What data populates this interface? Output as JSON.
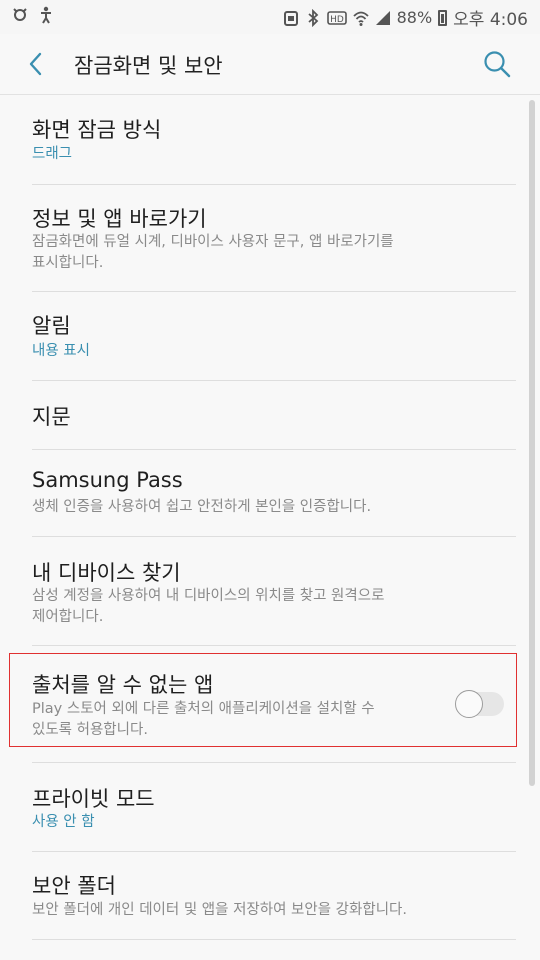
{
  "status_bar": {
    "battery": "88%",
    "time": "오후 4:06",
    "icons": [
      "notification-icon",
      "accessibility-icon",
      "storage-icon",
      "bluetooth-icon",
      "hd-icon",
      "wifi-icon",
      "signal-icon",
      "battery-icon"
    ]
  },
  "header": {
    "title": "잠금화면 및 보안",
    "back_icon": "back-arrow-icon",
    "search_icon": "search-icon"
  },
  "accent_color": "#3a8fb0",
  "items": [
    {
      "title": "화면 잠금 방식",
      "subtitle": "드래그"
    },
    {
      "title": "정보 및 앱 바로가기",
      "subtitle_l1": "잠금화면에 듀얼 시계, 디바이스 사용자 문구, 앱 바로가기를",
      "subtitle_l2": "표시합니다."
    },
    {
      "title": "알림",
      "subtitle": "내용 표시"
    },
    {
      "title": "지문"
    },
    {
      "title": "Samsung Pass",
      "subtitle": "생체 인증을 사용하여 쉽고 안전하게 본인을 인증합니다."
    },
    {
      "title": "내 디바이스 찾기",
      "subtitle_l1": "삼성 계정을 사용하여 내 디바이스의 위치를 찾고 원격으로",
      "subtitle_l2": "제어합니다."
    },
    {
      "title": "출처를 알 수 없는 앱",
      "subtitle_l1": "Play 스토어 외에 다른 출처의 애플리케이션을 설치할 수",
      "subtitle_l2": "있도록 허용합니다.",
      "toggle_on": false
    },
    {
      "title": "프라이빗 모드",
      "subtitle": "사용 안 함"
    },
    {
      "title": "보안 폴더",
      "subtitle": "보안 폴더에 개인 데이터 및 앱을 저장하여 보안을 강화합니다."
    }
  ]
}
